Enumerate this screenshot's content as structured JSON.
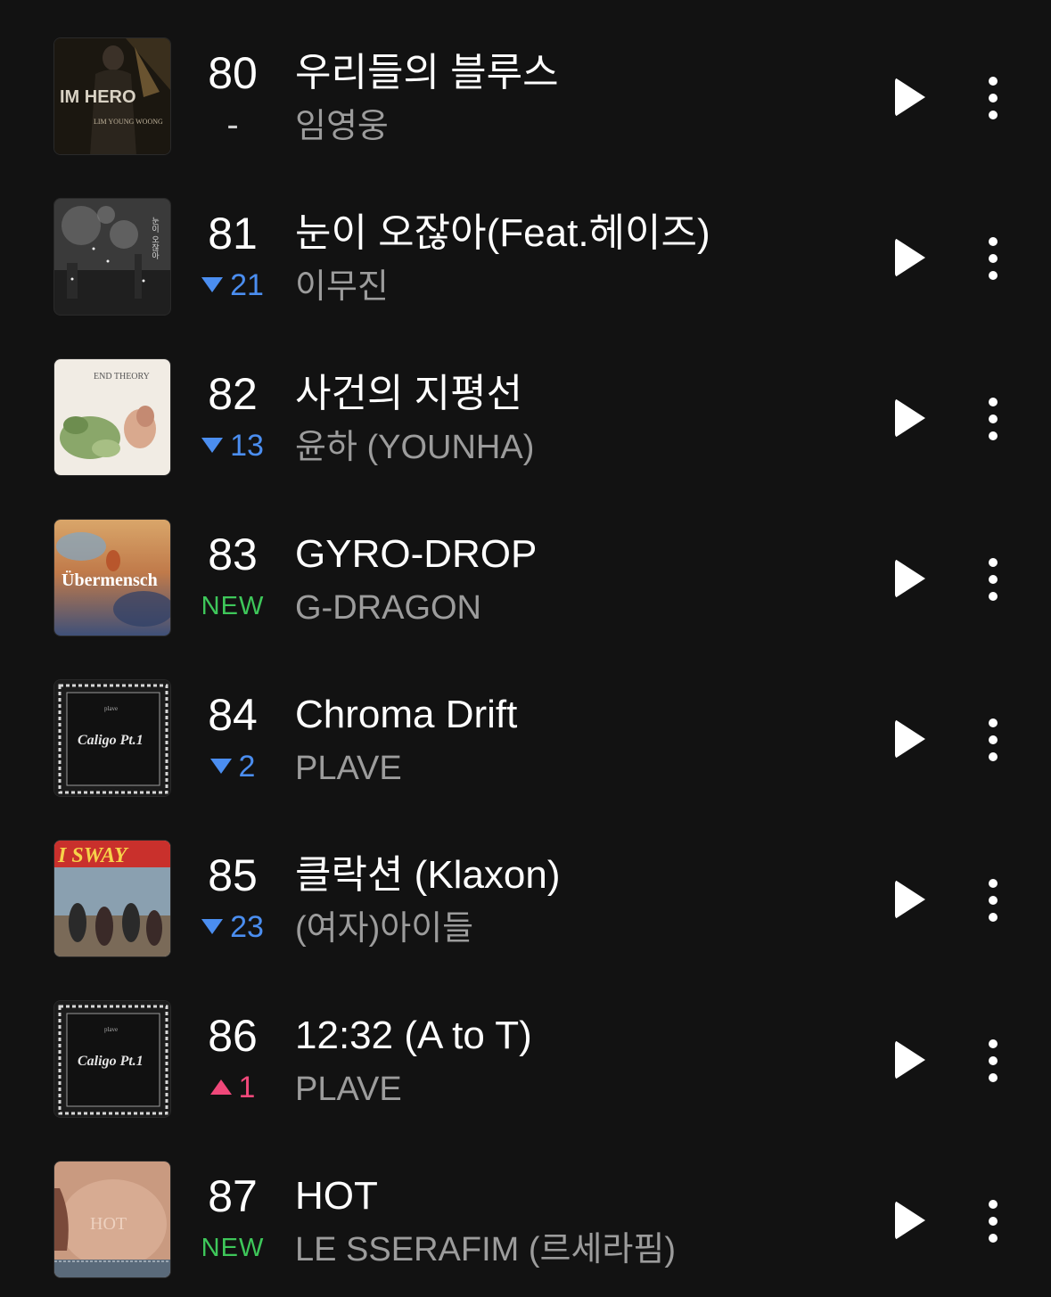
{
  "colors": {
    "background": "#121212",
    "title": "#ffffff",
    "artist": "#9c9c9c",
    "rank_down": "#4b8ef0",
    "rank_up": "#f0487a",
    "rank_new": "#3ec75a"
  },
  "songs": [
    {
      "rank": "80",
      "change_type": "same",
      "change_text": "-",
      "title": "우리들의 블루스",
      "artist": "임영웅",
      "cover_icon": "album-cover-im-hero"
    },
    {
      "rank": "81",
      "change_type": "down",
      "change_text": "21",
      "title": "눈이 오잖아(Feat.헤이즈)",
      "artist": "이무진",
      "cover_icon": "album-cover-snow"
    },
    {
      "rank": "82",
      "change_type": "down",
      "change_text": "13",
      "title": "사건의 지평선",
      "artist": "윤하 (YOUNHA)",
      "cover_icon": "album-cover-end-theory"
    },
    {
      "rank": "83",
      "change_type": "new",
      "change_text": "NEW",
      "title": "GYRO-DROP",
      "artist": "G-DRAGON",
      "cover_icon": "album-cover-ubermensch"
    },
    {
      "rank": "84",
      "change_type": "down",
      "change_text": "2",
      "title": "Chroma Drift",
      "artist": "PLAVE",
      "cover_icon": "album-cover-caligo"
    },
    {
      "rank": "85",
      "change_type": "down",
      "change_text": "23",
      "title": "클락션 (Klaxon)",
      "artist": "(여자)아이들",
      "cover_icon": "album-cover-i-sway"
    },
    {
      "rank": "86",
      "change_type": "up",
      "change_text": "1",
      "title": "12:32 (A to T)",
      "artist": "PLAVE",
      "cover_icon": "album-cover-caligo"
    },
    {
      "rank": "87",
      "change_type": "new",
      "change_text": "NEW",
      "title": "HOT",
      "artist": "LE SSERAFIM (르세라핌)",
      "cover_icon": "album-cover-hot"
    }
  ],
  "cover_text": {
    "im_hero": "IM HERO",
    "im_hero_sub": "LIM YOUNG WOONG",
    "snow_side": "눈이 오잖아",
    "end_theory": "END THEORY",
    "ubermensch": "Übermensch",
    "caligo": "Caligo Pt.1",
    "caligo_brand": "plave",
    "i_sway": "I SWAY",
    "hot": "HOT"
  }
}
